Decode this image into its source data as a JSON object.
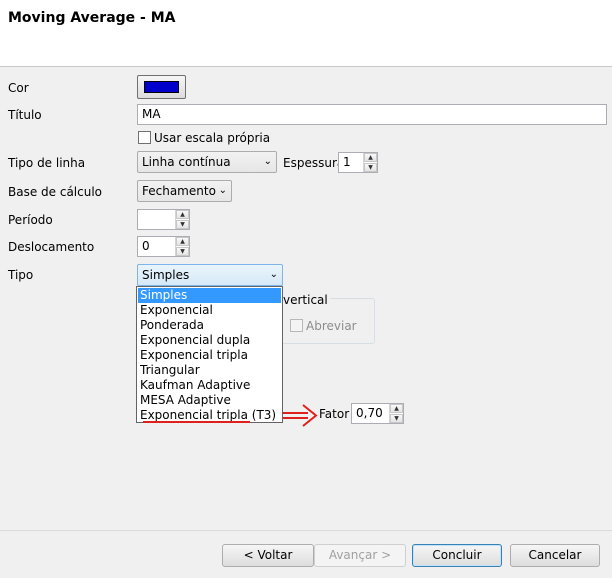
{
  "window": {
    "title": "Moving Average - MA"
  },
  "form": {
    "color": {
      "label": "Cor",
      "value": "#0000cc"
    },
    "title": {
      "label": "Título",
      "value": "MA"
    },
    "own_scale": {
      "label": "Usar escala própria",
      "checked": false
    },
    "line_type": {
      "label": "Tipo de linha",
      "value": "Linha contínua"
    },
    "thickness": {
      "label": "Espessura",
      "value": "1"
    },
    "calc_base": {
      "label": "Base de cálculo",
      "value": "Fechamento"
    },
    "period": {
      "label": "Período",
      "value": ""
    },
    "offset": {
      "label": "Deslocamento",
      "value": "0"
    },
    "type": {
      "label": "Tipo",
      "value": "Simples",
      "options": [
        "Simples",
        "Exponencial",
        "Ponderada",
        "Exponencial dupla",
        "Exponencial tripla",
        "Triangular",
        "Kaufman Adaptive",
        "MESA Adaptive",
        "Exponencial tripla (T3)"
      ]
    },
    "vertical_group": {
      "label_fragment": "vertical",
      "abbreviate_label": "Abreviar",
      "abbreviate_enabled": false
    },
    "factor": {
      "label": "Fator",
      "value": "0,70"
    }
  },
  "annotation": {
    "color": "#e0201c"
  },
  "buttons": {
    "back": "< Voltar",
    "next": "Avançar >",
    "finish": "Concluir",
    "cancel": "Cancelar"
  }
}
